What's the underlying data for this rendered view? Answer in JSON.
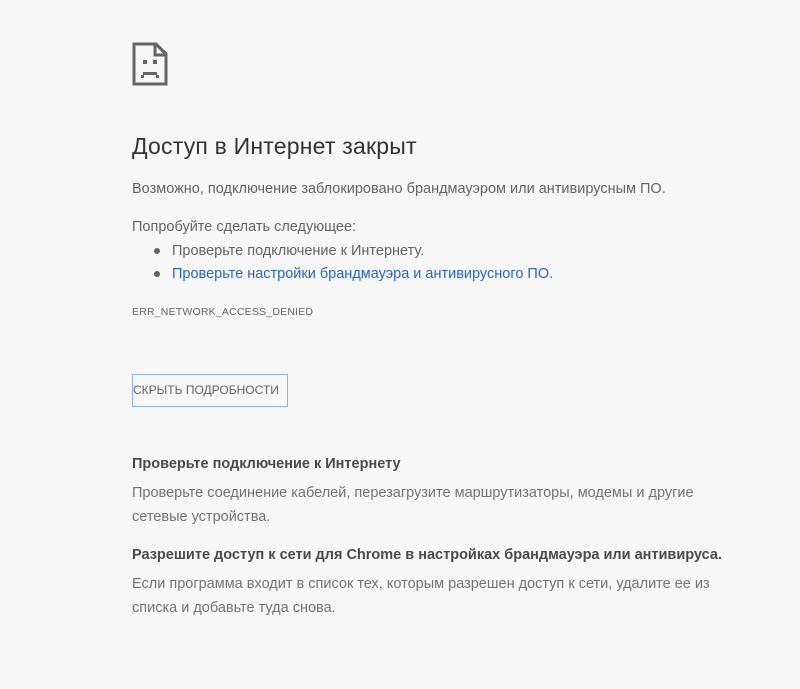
{
  "icon": "sad-page-icon",
  "error": {
    "title": "Доступ в Интернет закрыт",
    "summary": "Возможно, подключение заблокировано брандмауэром или антивирусным ПО.",
    "try_heading": "Попробуйте сделать следующее:",
    "suggestions": [
      {
        "text": "Проверьте подключение к Интернету.",
        "is_link": false
      },
      {
        "text": "Проверьте настройки брандмауэра и антивирусного ПО",
        "suffix": ".",
        "is_link": true
      }
    ],
    "code": "ERR_NETWORK_ACCESS_DENIED"
  },
  "details_button": {
    "label": "СКРЫТЬ ПОДРОБНОСТИ"
  },
  "details": [
    {
      "heading": "Проверьте подключение к Интернету",
      "body": "Проверьте соединение кабелей, перезагрузите маршрутизаторы, модемы и другие сетевые устройства."
    },
    {
      "heading": "Разрешите доступ к сети для Chrome в настройках брандмауэра или антивируса.",
      "body": "Если программа входит в список тех, которым разрешен доступ к сети, удалите ее из списка и добавьте туда снова."
    }
  ],
  "colors": {
    "background": "#f7f7f7",
    "link": "#2566c9",
    "button_border": "#8fb1e6",
    "text": "#646464",
    "title": "#333333"
  }
}
